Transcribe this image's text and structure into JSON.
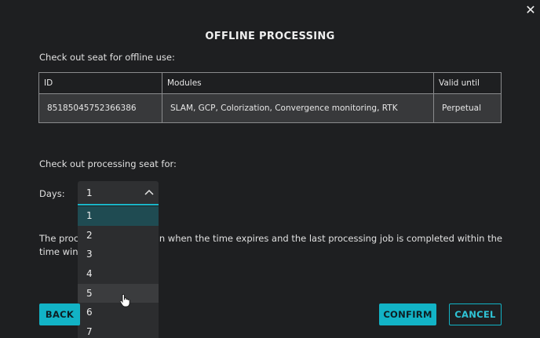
{
  "dialog": {
    "title": "OFFLINE PROCESSING",
    "close_icon": "close-icon",
    "seat_prompt": "Check out seat for offline use:"
  },
  "table": {
    "headers": [
      "ID",
      "Modules",
      "Valid until"
    ],
    "rows": [
      [
        "85185045752366386",
        "SLAM, GCP, Colorization, Convergence monitoring, RTK",
        "Perpetual"
      ]
    ]
  },
  "processing": {
    "prompt": "Check out processing seat for:",
    "days_label": "Days:",
    "selected_value": "1",
    "options": [
      "1",
      "2",
      "3",
      "4",
      "5",
      "6",
      "7"
    ],
    "hovered_option": "5",
    "info_line1_start": "The proce",
    "info_line1_end": "d back in when the time expires and the last processing job is completed within the",
    "info_line2_start": "time wind"
  },
  "buttons": {
    "back": "BACK",
    "confirm": "CONFIRM",
    "cancel": "CANCEL"
  },
  "colors": {
    "accent": "#12b3c6",
    "background": "#1e1f21",
    "selected_option": "#1f4b52"
  }
}
